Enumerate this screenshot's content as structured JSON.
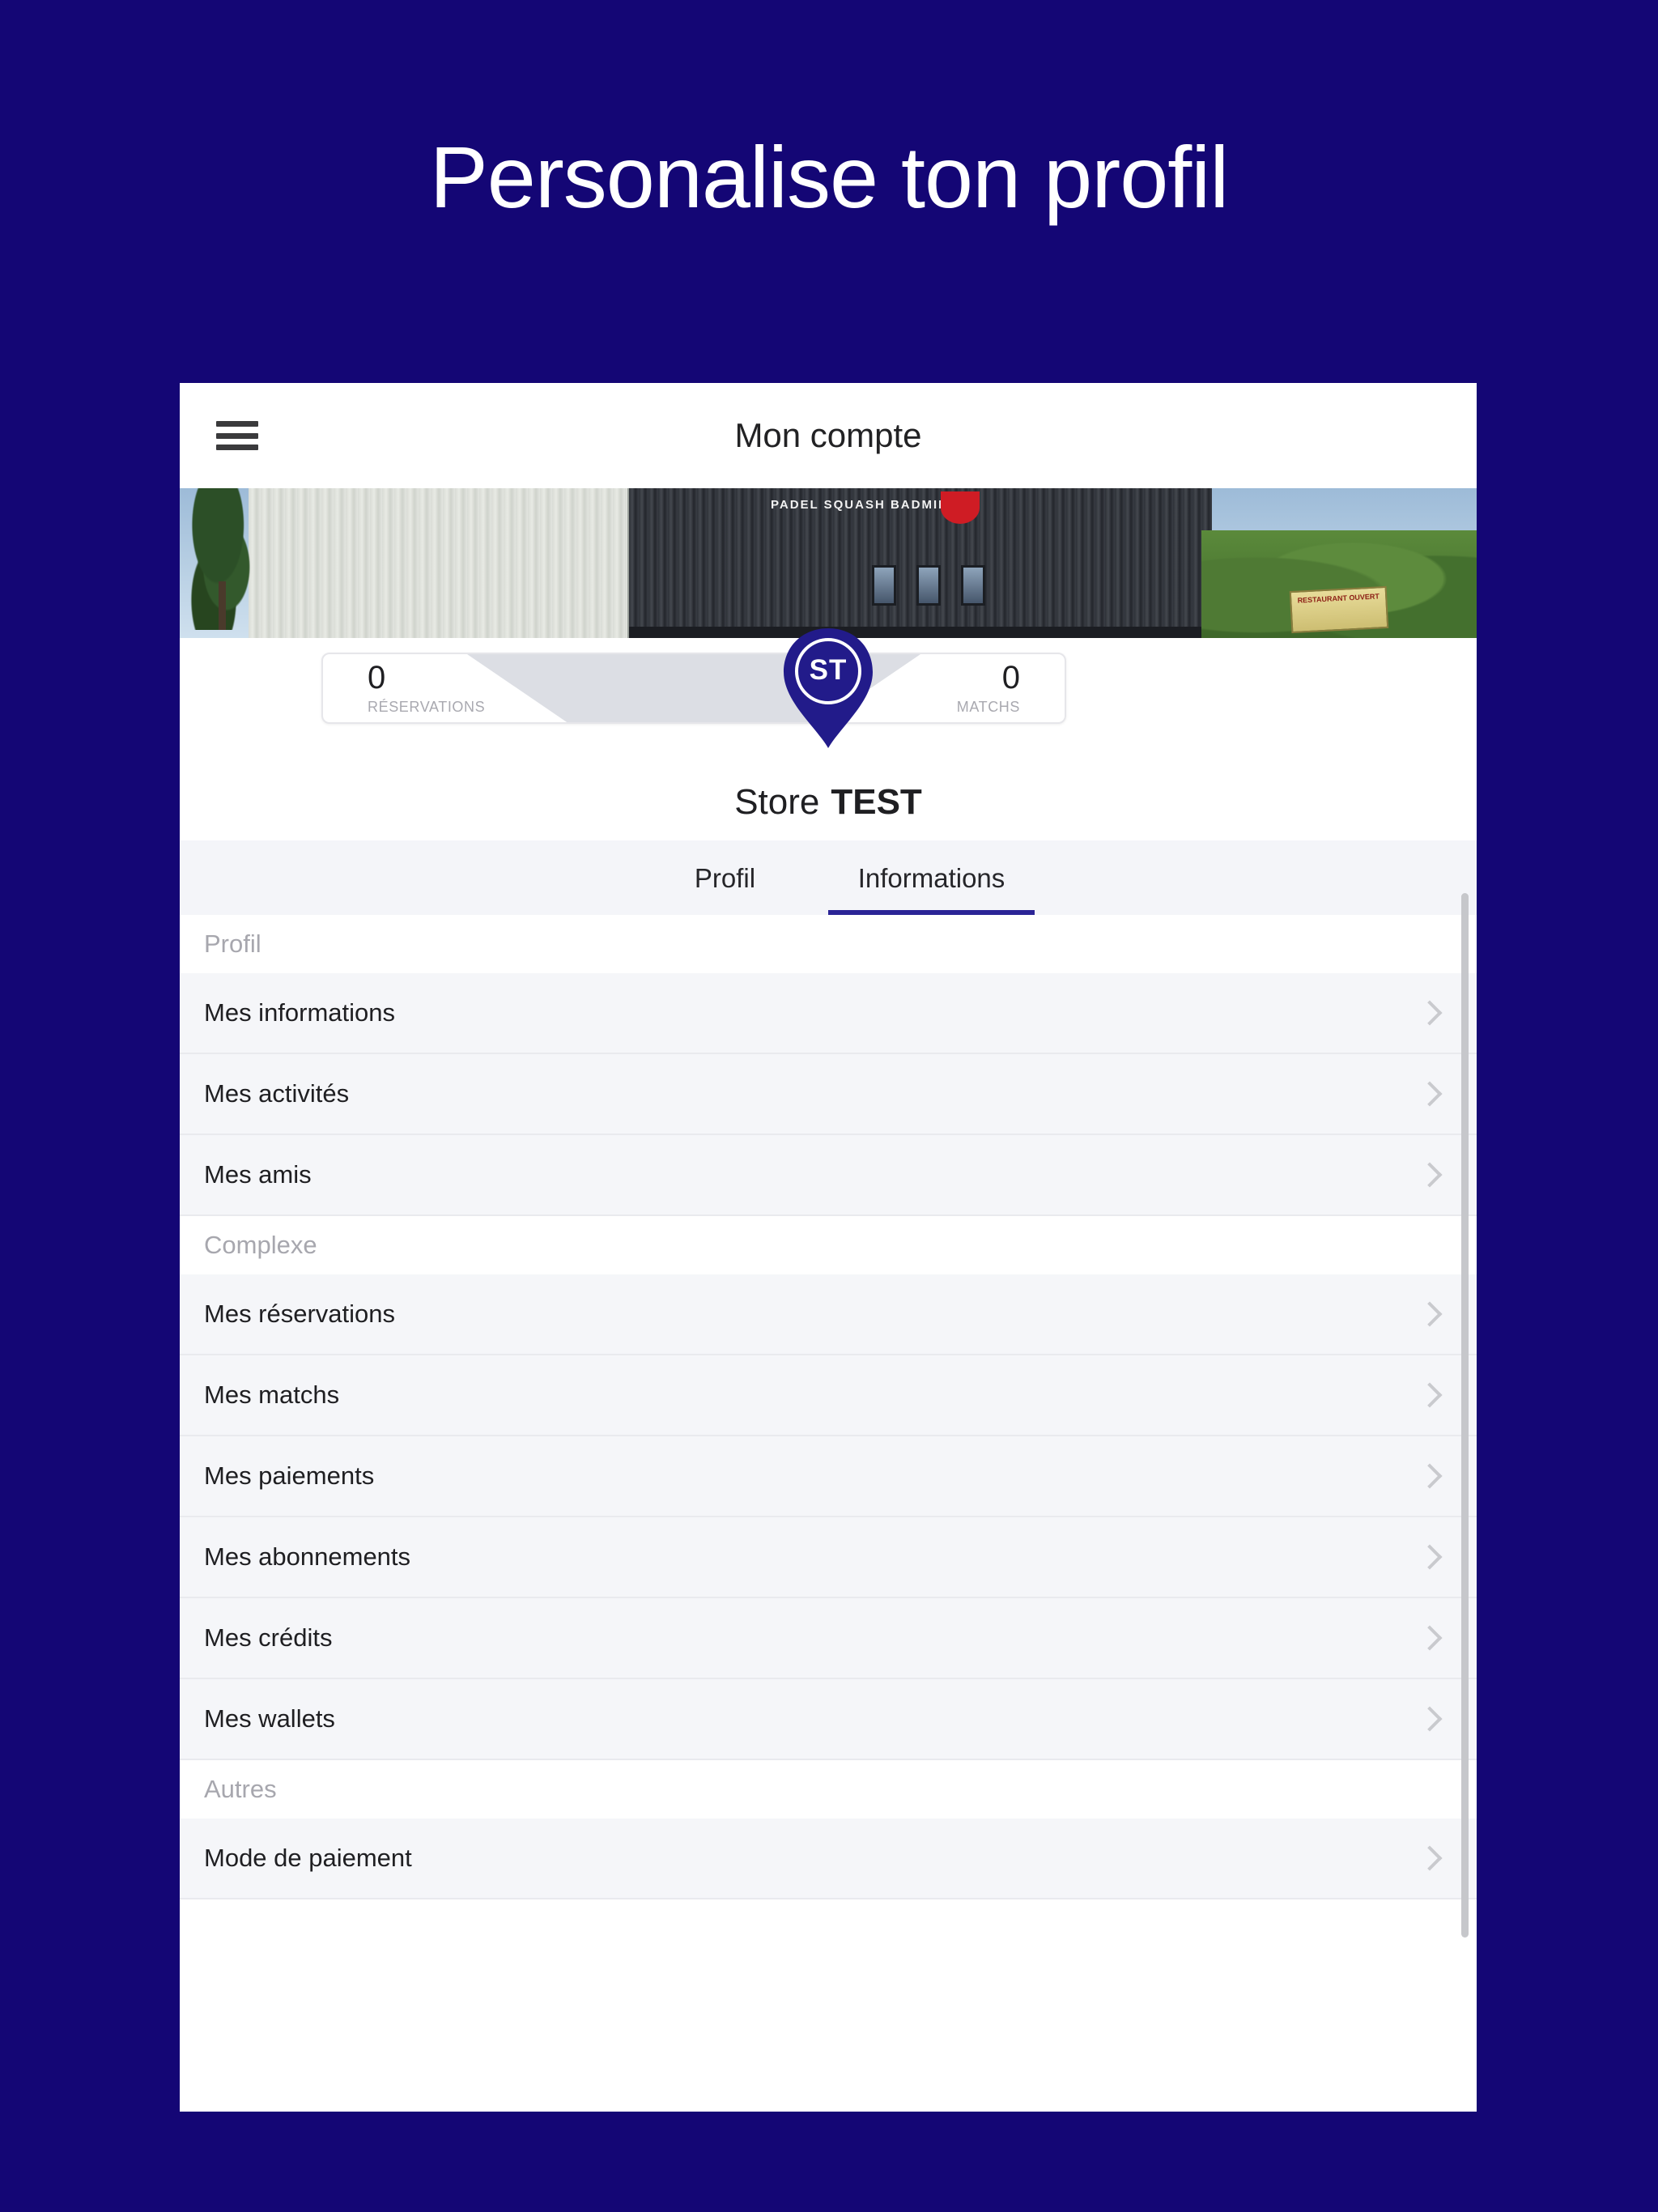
{
  "promo": {
    "headline": "Personalise ton profil"
  },
  "colors": {
    "page_background": "#140675",
    "brand_navy": "#221b8a",
    "tab_active_underline": "#2b2496",
    "list_background": "#f5f6f9",
    "section_text": "#a7a7ae",
    "chevron": "#c9cace"
  },
  "app": {
    "header": {
      "menu_icon": "hamburger-icon",
      "title": "Mon compte"
    },
    "banner": {
      "facade_sign": "PADEL SQUASH BADMINTON",
      "placard_text": "RESTAURANT OUVERT"
    },
    "stats": [
      {
        "value": "0",
        "label": "RÉSERVATIONS"
      },
      {
        "value": "0",
        "label": "MATCHS"
      }
    ],
    "avatar": {
      "initials": "ST",
      "shape": "map-pin"
    },
    "store": {
      "prefix": "Store",
      "name": "TEST"
    },
    "tabs": [
      {
        "label": "Profil",
        "active": false
      },
      {
        "label": "Informations",
        "active": true
      }
    ],
    "sections": [
      {
        "title": "Profil",
        "items": [
          {
            "label": "Mes informations"
          },
          {
            "label": "Mes activités"
          },
          {
            "label": "Mes amis"
          }
        ]
      },
      {
        "title": "Complexe",
        "items": [
          {
            "label": "Mes réservations"
          },
          {
            "label": "Mes matchs"
          },
          {
            "label": "Mes paiements"
          },
          {
            "label": "Mes abonnements"
          },
          {
            "label": "Mes crédits"
          },
          {
            "label": "Mes wallets"
          }
        ]
      },
      {
        "title": "Autres",
        "items": [
          {
            "label": "Mode de paiement"
          }
        ]
      }
    ]
  }
}
